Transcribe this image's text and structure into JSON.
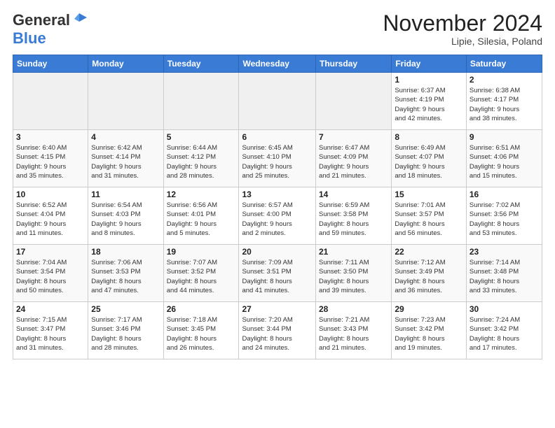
{
  "header": {
    "logo_general": "General",
    "logo_blue": "Blue",
    "month_title": "November 2024",
    "subtitle": "Lipie, Silesia, Poland"
  },
  "weekdays": [
    "Sunday",
    "Monday",
    "Tuesday",
    "Wednesday",
    "Thursday",
    "Friday",
    "Saturday"
  ],
  "weeks": [
    [
      {
        "day": "",
        "info": ""
      },
      {
        "day": "",
        "info": ""
      },
      {
        "day": "",
        "info": ""
      },
      {
        "day": "",
        "info": ""
      },
      {
        "day": "",
        "info": ""
      },
      {
        "day": "1",
        "info": "Sunrise: 6:37 AM\nSunset: 4:19 PM\nDaylight: 9 hours\nand 42 minutes."
      },
      {
        "day": "2",
        "info": "Sunrise: 6:38 AM\nSunset: 4:17 PM\nDaylight: 9 hours\nand 38 minutes."
      }
    ],
    [
      {
        "day": "3",
        "info": "Sunrise: 6:40 AM\nSunset: 4:15 PM\nDaylight: 9 hours\nand 35 minutes."
      },
      {
        "day": "4",
        "info": "Sunrise: 6:42 AM\nSunset: 4:14 PM\nDaylight: 9 hours\nand 31 minutes."
      },
      {
        "day": "5",
        "info": "Sunrise: 6:44 AM\nSunset: 4:12 PM\nDaylight: 9 hours\nand 28 minutes."
      },
      {
        "day": "6",
        "info": "Sunrise: 6:45 AM\nSunset: 4:10 PM\nDaylight: 9 hours\nand 25 minutes."
      },
      {
        "day": "7",
        "info": "Sunrise: 6:47 AM\nSunset: 4:09 PM\nDaylight: 9 hours\nand 21 minutes."
      },
      {
        "day": "8",
        "info": "Sunrise: 6:49 AM\nSunset: 4:07 PM\nDaylight: 9 hours\nand 18 minutes."
      },
      {
        "day": "9",
        "info": "Sunrise: 6:51 AM\nSunset: 4:06 PM\nDaylight: 9 hours\nand 15 minutes."
      }
    ],
    [
      {
        "day": "10",
        "info": "Sunrise: 6:52 AM\nSunset: 4:04 PM\nDaylight: 9 hours\nand 11 minutes."
      },
      {
        "day": "11",
        "info": "Sunrise: 6:54 AM\nSunset: 4:03 PM\nDaylight: 9 hours\nand 8 minutes."
      },
      {
        "day": "12",
        "info": "Sunrise: 6:56 AM\nSunset: 4:01 PM\nDaylight: 9 hours\nand 5 minutes."
      },
      {
        "day": "13",
        "info": "Sunrise: 6:57 AM\nSunset: 4:00 PM\nDaylight: 9 hours\nand 2 minutes."
      },
      {
        "day": "14",
        "info": "Sunrise: 6:59 AM\nSunset: 3:58 PM\nDaylight: 8 hours\nand 59 minutes."
      },
      {
        "day": "15",
        "info": "Sunrise: 7:01 AM\nSunset: 3:57 PM\nDaylight: 8 hours\nand 56 minutes."
      },
      {
        "day": "16",
        "info": "Sunrise: 7:02 AM\nSunset: 3:56 PM\nDaylight: 8 hours\nand 53 minutes."
      }
    ],
    [
      {
        "day": "17",
        "info": "Sunrise: 7:04 AM\nSunset: 3:54 PM\nDaylight: 8 hours\nand 50 minutes."
      },
      {
        "day": "18",
        "info": "Sunrise: 7:06 AM\nSunset: 3:53 PM\nDaylight: 8 hours\nand 47 minutes."
      },
      {
        "day": "19",
        "info": "Sunrise: 7:07 AM\nSunset: 3:52 PM\nDaylight: 8 hours\nand 44 minutes."
      },
      {
        "day": "20",
        "info": "Sunrise: 7:09 AM\nSunset: 3:51 PM\nDaylight: 8 hours\nand 41 minutes."
      },
      {
        "day": "21",
        "info": "Sunrise: 7:11 AM\nSunset: 3:50 PM\nDaylight: 8 hours\nand 39 minutes."
      },
      {
        "day": "22",
        "info": "Sunrise: 7:12 AM\nSunset: 3:49 PM\nDaylight: 8 hours\nand 36 minutes."
      },
      {
        "day": "23",
        "info": "Sunrise: 7:14 AM\nSunset: 3:48 PM\nDaylight: 8 hours\nand 33 minutes."
      }
    ],
    [
      {
        "day": "24",
        "info": "Sunrise: 7:15 AM\nSunset: 3:47 PM\nDaylight: 8 hours\nand 31 minutes."
      },
      {
        "day": "25",
        "info": "Sunrise: 7:17 AM\nSunset: 3:46 PM\nDaylight: 8 hours\nand 28 minutes."
      },
      {
        "day": "26",
        "info": "Sunrise: 7:18 AM\nSunset: 3:45 PM\nDaylight: 8 hours\nand 26 minutes."
      },
      {
        "day": "27",
        "info": "Sunrise: 7:20 AM\nSunset: 3:44 PM\nDaylight: 8 hours\nand 24 minutes."
      },
      {
        "day": "28",
        "info": "Sunrise: 7:21 AM\nSunset: 3:43 PM\nDaylight: 8 hours\nand 21 minutes."
      },
      {
        "day": "29",
        "info": "Sunrise: 7:23 AM\nSunset: 3:42 PM\nDaylight: 8 hours\nand 19 minutes."
      },
      {
        "day": "30",
        "info": "Sunrise: 7:24 AM\nSunset: 3:42 PM\nDaylight: 8 hours\nand 17 minutes."
      }
    ]
  ]
}
